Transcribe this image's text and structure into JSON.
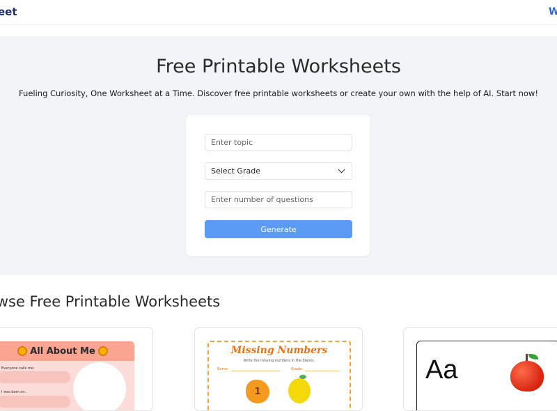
{
  "header": {
    "brand": "eet",
    "nav_link": "W"
  },
  "hero": {
    "title": "Free Printable Worksheets",
    "subtitle": "Fueling Curiosity, One Worksheet at a Time. Discover free printable worksheets or create your own with the help of AI. Start now!"
  },
  "form": {
    "topic_placeholder": "Enter topic",
    "grade_selected": "Select Grade",
    "questions_placeholder": "Enter number of questions",
    "generate_label": "Generate"
  },
  "browse": {
    "title": "owse Free Printable Worksheets",
    "cards": [
      {
        "title": "All About Me",
        "label_1": "Everyone calls me:",
        "label_2": "I was born on:"
      },
      {
        "title": "Missing Numbers",
        "subtitle": "Write the missing numbers in the blanks.",
        "name_label": "Name:",
        "grade_label": "Grade:",
        "number": "1"
      },
      {
        "letters": "Aa"
      }
    ]
  },
  "colors": {
    "brand": "#1d2b6b",
    "nav_link": "#2a66d9",
    "hero_bg": "#f3f4f7",
    "generate_button": "#5c9bf5",
    "card1_banner": "#f9a592",
    "card2_accent": "#e3741c"
  },
  "icons": {
    "grade_select": "chevron-down-icon",
    "card1": [
      "sun-icon",
      "flower-shape"
    ],
    "card2": [
      "number-blob",
      "lemon-icon"
    ],
    "card3": [
      "apple-icon"
    ]
  }
}
